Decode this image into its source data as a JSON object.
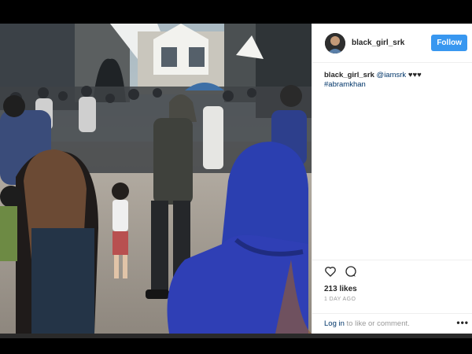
{
  "post": {
    "username": "black_girl_srk",
    "follow_label": "Follow",
    "caption_user": "black_girl_srk",
    "caption_mention": "@iamsrk",
    "caption_hearts": "♥♥♥",
    "caption_hashtag": "#abramkhan",
    "likes": "213 likes",
    "time": "1 DAY AGO",
    "login_link": "Log in",
    "login_rest": "to like or comment.",
    "more_label": "•••"
  },
  "icons": {
    "like": "heart-icon",
    "comment": "comment-icon"
  },
  "colors": {
    "follow_button": "#3897f0",
    "link": "#003569"
  }
}
